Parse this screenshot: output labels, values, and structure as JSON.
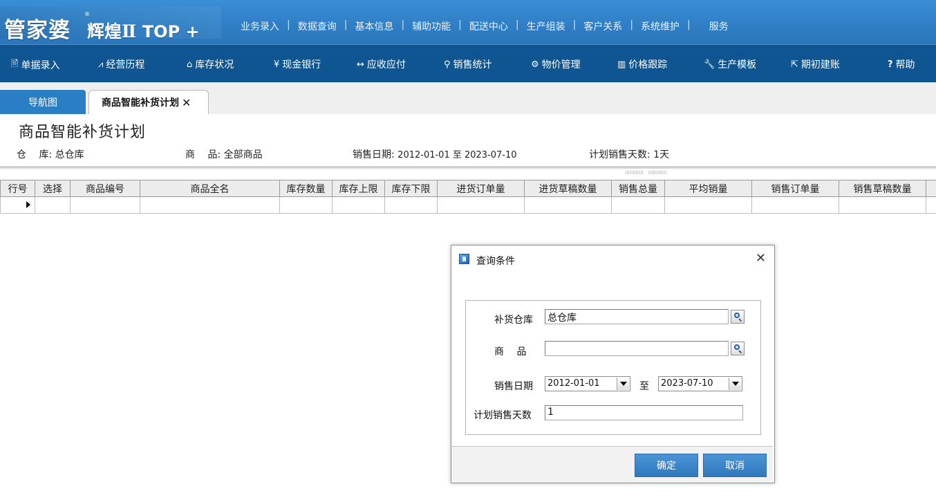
{
  "app": {
    "logo_main": "管家婆",
    "logo_reg": "®",
    "logo_sub": "辉煌Ⅱ",
    "logo_top": "TOP +"
  },
  "top_menu": [
    "业务录入",
    "数据查询",
    "基本信息",
    "辅助功能",
    "配送中心",
    "生产组装",
    "客户关系",
    "系统维护",
    "服务"
  ],
  "toolbar": [
    {
      "label": "单据录入",
      "icon": "document-icon",
      "glyph": "🖹"
    },
    {
      "label": "经营历程",
      "icon": "line-chart-icon",
      "glyph": "⩘"
    },
    {
      "label": "库存状况",
      "icon": "home-icon",
      "glyph": "⌂"
    },
    {
      "label": "现金银行",
      "icon": "yen-icon",
      "glyph": "¥"
    },
    {
      "label": "应收应付",
      "icon": "transfer-icon",
      "glyph": "↔"
    },
    {
      "label": "销售统计",
      "icon": "search-icon",
      "glyph": "⚲"
    },
    {
      "label": "物价管理",
      "icon": "gear-icon",
      "glyph": "⚙"
    },
    {
      "label": "价格跟踪",
      "icon": "bar-chart-icon",
      "glyph": "▥"
    },
    {
      "label": "生产模板",
      "icon": "wrench-icon",
      "glyph": "🔧"
    },
    {
      "label": "期初建账",
      "icon": "external-link-icon",
      "glyph": "⇱"
    },
    {
      "label": "帮助",
      "icon": "help-icon",
      "glyph": "?"
    }
  ],
  "tabs": {
    "nav_label": "导航图",
    "active_label": "商品智能补货计划",
    "close_glyph": "✕"
  },
  "page": {
    "title": "商品智能补货计划",
    "warehouse_label": "仓　 库:",
    "warehouse_value": "总仓库",
    "product_label": "商　 品:",
    "product_value": "全部商品",
    "date_label": "销售日期:",
    "date_value": "2012-01-01 至 2023-07-10",
    "days_label": "计划销售天数:",
    "days_value": "1天"
  },
  "grid": {
    "columns": [
      "行号",
      "选择",
      "商品编号",
      "商品全名",
      "库存数量",
      "库存上限",
      "库存下限",
      "进货订单量",
      "进货草稿数量",
      "销售总量",
      "平均销量",
      "销售订单量",
      "销售草稿数量"
    ]
  },
  "dialog": {
    "title": "查询条件",
    "close_glyph": "✕",
    "warehouse_label": "补货仓库",
    "warehouse_value": "总仓库",
    "product_label": "商　 品",
    "product_value": "",
    "date_label": "销售日期",
    "date_from": "2012-01-01",
    "date_to_label": "至",
    "date_to": "2023-07-10",
    "days_label": "计划销售天数",
    "days_value": "1",
    "ok_label": "确定",
    "cancel_label": "取消"
  },
  "colors": {
    "topbar": "#2f7fc6",
    "toolbar": "#0f5592",
    "tab_nav": "#2a7ec4",
    "button": "#2f78bd"
  }
}
